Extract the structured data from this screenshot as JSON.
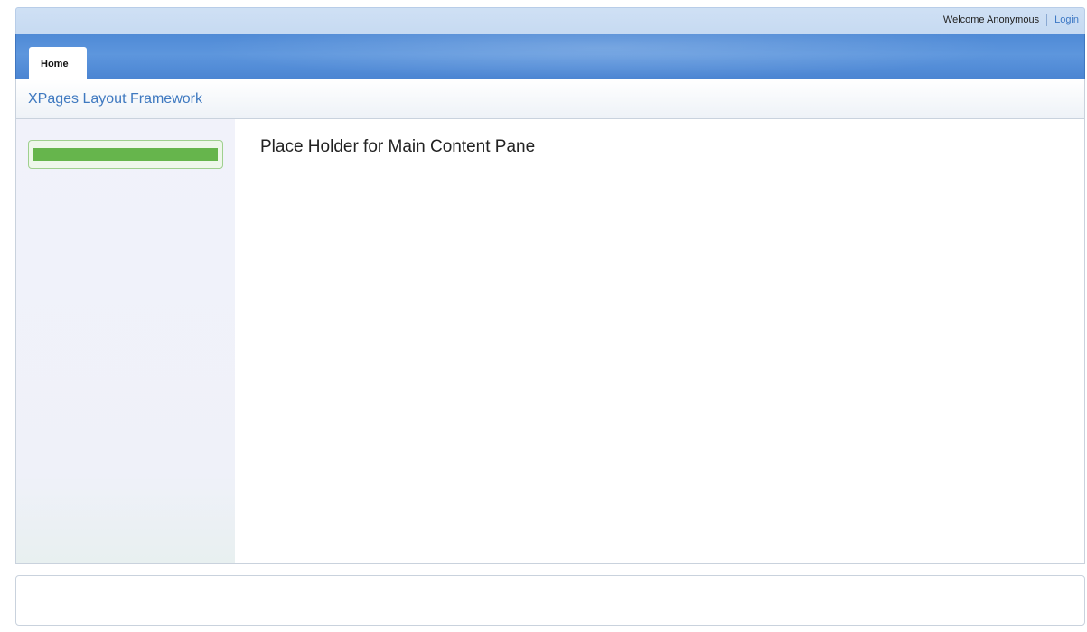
{
  "utility": {
    "welcome": "Welcome Anonymous",
    "login": "Login"
  },
  "tabs": [
    {
      "label": "Home",
      "selected": true
    }
  ],
  "place": {
    "title": "XPages Layout Framework"
  },
  "main": {
    "heading": "Place Holder for Main Content Pane"
  },
  "colors": {
    "banner": "#4f8ad6",
    "utility_bar": "#cfe0f4",
    "place_title": "#3f79c0",
    "nav_highlight": "#66b54c",
    "left_column": "#f1f2fa"
  }
}
